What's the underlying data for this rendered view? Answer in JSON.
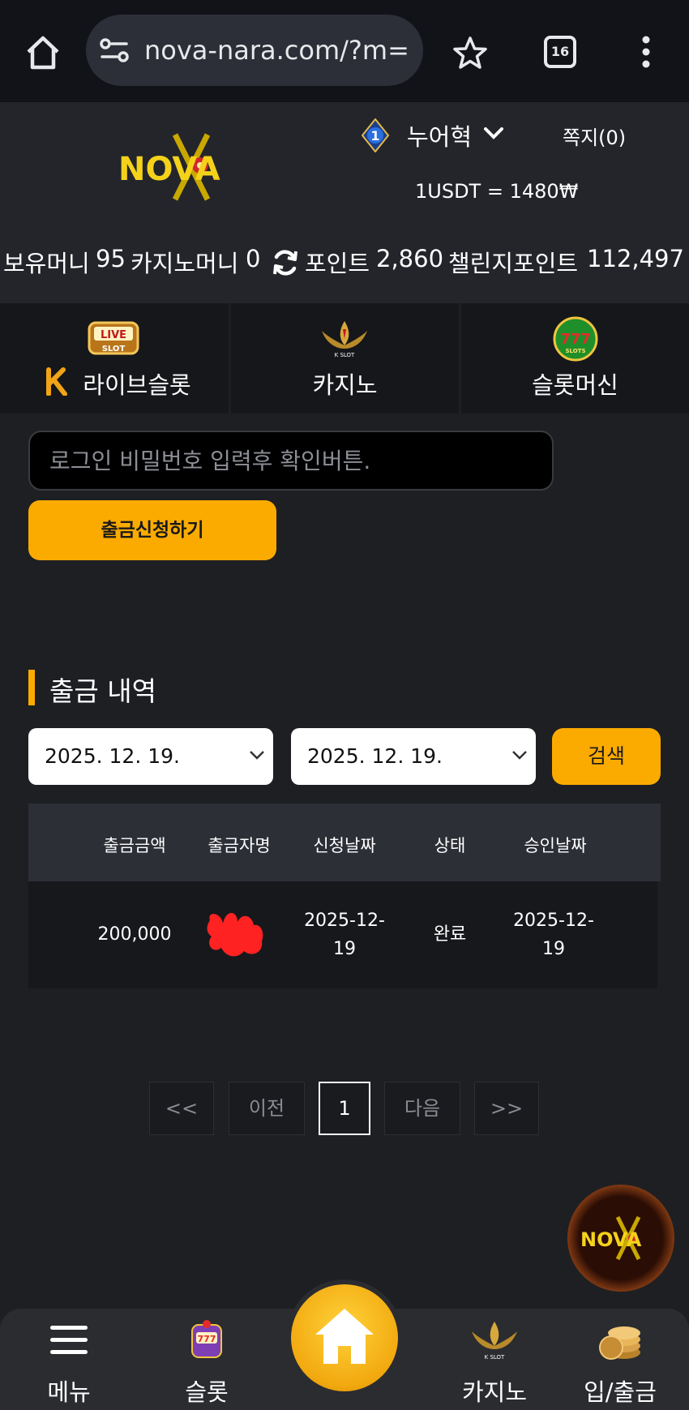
{
  "browser": {
    "url": "nova-nara.com/?m=",
    "tab_count": "16"
  },
  "header": {
    "logo_text": "NOVA",
    "level": "1",
    "username": "누어혁",
    "messages": "쪽지(0)",
    "exchange_rate": "1USDT = 1480₩"
  },
  "balance": {
    "money_label": "보유머니",
    "money_value": "95",
    "casino_label": "카지노머니",
    "casino_value": "0",
    "point_label": "포인트",
    "point_value": "2,860",
    "challenge_label": "챌린지포인트",
    "challenge_value": "112,497"
  },
  "categories": [
    {
      "label": "라이브슬롯",
      "badge": "LIVE SLOT"
    },
    {
      "label": "카지노",
      "badge": "K SLOT"
    },
    {
      "label": "슬롯머신",
      "badge": "777 SLOTS"
    }
  ],
  "withdraw_form": {
    "password_placeholder": "로그인 비밀번호 입력후 확인버튼.",
    "submit_label": "출금신청하기"
  },
  "history": {
    "title": "출금 내역",
    "date_from": "2025. 12. 19.",
    "date_to": "2025. 12. 19.",
    "search_label": "검색",
    "columns": [
      "출금금액",
      "출금자명",
      "신청날짜",
      "상태",
      "승인날짜"
    ],
    "rows": [
      {
        "amount": "200,000",
        "name": "",
        "request_date_1": "2025-12-",
        "request_date_2": "19",
        "status": "완료",
        "approve_date_1": "2025-12-",
        "approve_date_2": "19"
      }
    ]
  },
  "pagination": {
    "first": "<<",
    "prev": "이전",
    "current": "1",
    "next": "다음",
    "last": ">>"
  },
  "bottom_nav": {
    "menu": "메뉴",
    "slot": "슬롯",
    "casino": "카지노",
    "banking": "입/출금"
  },
  "colors": {
    "accent": "#fbab00",
    "background": "#1e1f23"
  }
}
